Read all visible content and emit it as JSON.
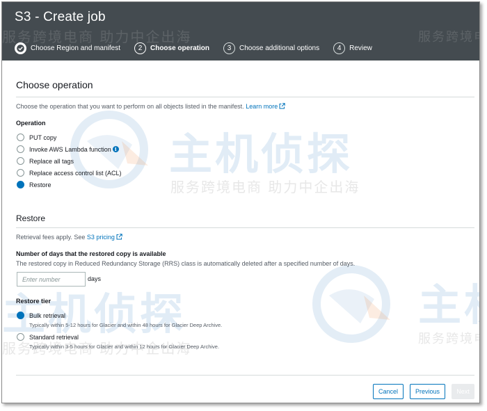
{
  "header": {
    "title": "S3 - Create job",
    "steps": [
      {
        "number": "1",
        "label": "Choose Region and manifest",
        "state": "done"
      },
      {
        "number": "2",
        "label": "Choose operation",
        "state": "active"
      },
      {
        "number": "3",
        "label": "Choose additional options",
        "state": "pending"
      },
      {
        "number": "4",
        "label": "Review",
        "state": "pending"
      }
    ]
  },
  "choose_operation": {
    "title": "Choose operation",
    "description": "Choose the operation that you want to perform on all objects listed in the manifest.",
    "learn_more": "Learn more",
    "operation_label": "Operation",
    "options": [
      {
        "label": "PUT copy",
        "selected": false
      },
      {
        "label": "Invoke AWS Lambda function",
        "selected": false,
        "info": true
      },
      {
        "label": "Replace all tags",
        "selected": false
      },
      {
        "label": "Replace access control list (ACL)",
        "selected": false
      },
      {
        "label": "Restore",
        "selected": true
      }
    ]
  },
  "restore": {
    "title": "Restore",
    "fees_text": "Retrieval fees apply. See",
    "pricing_link": "S3 pricing",
    "days_label": "Number of days that the restored copy is available",
    "days_description": "The restored copy in Reduced Redundancy Storage (RRS) class is automatically deleted after a specified number of days.",
    "days_input_value": "",
    "days_input_placeholder": "Enter number",
    "days_unit": "days",
    "tier_label": "Restore tier",
    "tiers": [
      {
        "label": "Bulk retrieval",
        "description": "Typically within 5-12 hours for Glacier and within 48 hours for Glacier Deep Archive.",
        "selected": true
      },
      {
        "label": "Standard retrieval",
        "description": "Typically within 3-5 hours for Glacier and within 12 hours for Glacier Deep Archive.",
        "selected": false
      }
    ]
  },
  "footer": {
    "cancel": "Cancel",
    "previous": "Previous",
    "next": "Next"
  },
  "watermark": {
    "brand": "主机侦探",
    "slogan": "服务跨境电商 助力中企出海"
  },
  "colors": {
    "header_bg": "#444b50",
    "accent": "#0073bb",
    "rule": "#d5dbdb"
  }
}
